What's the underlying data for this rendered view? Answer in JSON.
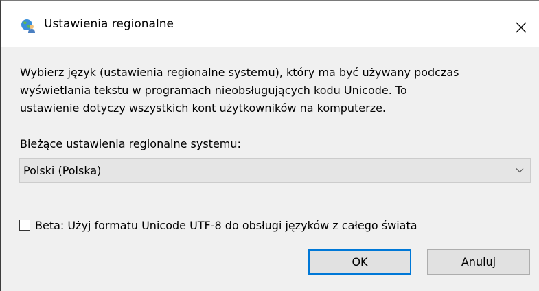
{
  "window": {
    "title": "Ustawienia regionalne",
    "icon": "globe-user-icon",
    "close_icon": "close-icon"
  },
  "description": {
    "lines": [
      "Wybierz język (ustawienia regionalne systemu), który ma być używany podczas",
      "wyświetlania tekstu w programach nieobsługujących kodu Unicode. To",
      "ustawienie dotyczy wszystkich kont użytkowników na komputerze."
    ]
  },
  "locale": {
    "label": "Bieżące ustawienia regionalne systemu:",
    "selected": "Polski (Polska)",
    "dropdown_icon": "chevron-down-icon"
  },
  "beta_option": {
    "label": "Beta: Użyj formatu Unicode UTF-8 do obsługi języków z całego świata",
    "checked": false
  },
  "buttons": {
    "ok_label": "OK",
    "cancel_label": "Anuluj"
  },
  "colors": {
    "default_button_border": "#0078d7",
    "dialog_background": "#f0f0f0"
  }
}
